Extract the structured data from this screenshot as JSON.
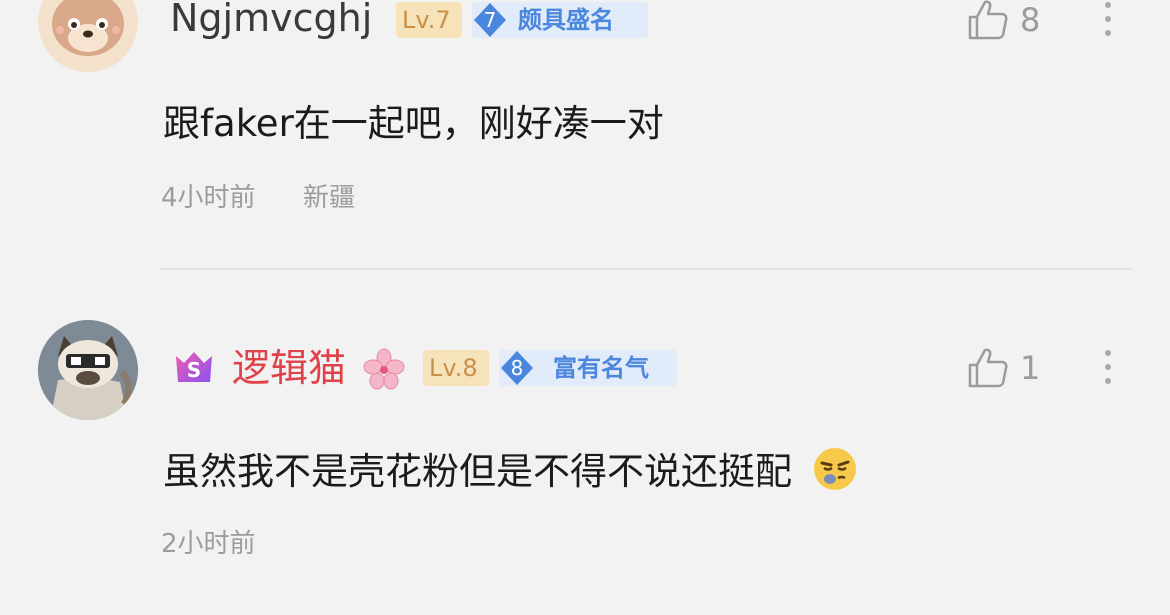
{
  "comments": [
    {
      "username": "Ngjmvcghj",
      "level": "Lv.7",
      "fame_level": "7",
      "fame_title": "颇具盛名",
      "like_count": "8",
      "content": "跟faker在一起吧，刚好凑一对",
      "time": "4小时前",
      "location": "新疆",
      "avatar_icon": "dog-avatar-icon"
    },
    {
      "username": "逻辑猫",
      "level": "Lv.8",
      "fame_level": "8",
      "fame_title": "富有名气",
      "like_count": "1",
      "content": "虽然我不是壳花粉但是不得不说还挺配",
      "time": "2小时前",
      "location": "",
      "vip_badge": "S",
      "avatar_icon": "siamese-cat-avatar-icon",
      "emoji": "smirk-emoji-icon"
    }
  ],
  "colors": {
    "background": "#f2f2f2",
    "username_default": "#3a3a3a",
    "username_vip": "#e0424b",
    "level_badge_bg": "#f7e3b9",
    "level_badge_text": "#c8914a",
    "fame_badge_bg": "#e1ebfa",
    "fame_badge_text": "#4c87de",
    "meta_text": "#9c9c9c"
  }
}
